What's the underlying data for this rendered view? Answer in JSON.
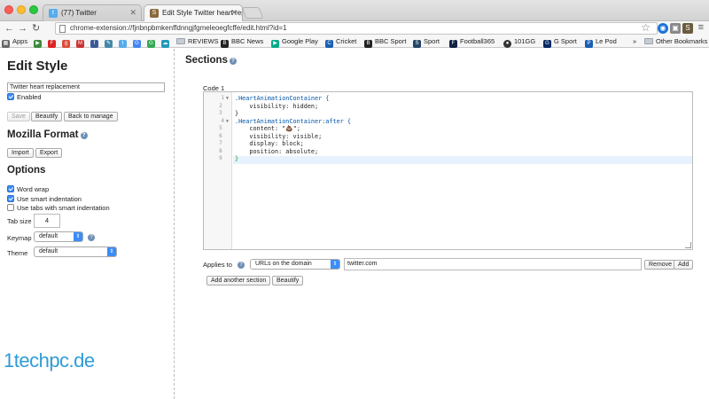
{
  "browser": {
    "tabs": [
      {
        "label": "(77) Twitter",
        "icon": "twitter-icon",
        "active": false
      },
      {
        "label": "Edit Style Twitter heart rep",
        "icon": "stylish-icon",
        "active": true
      }
    ],
    "url": "chrome-extension://fjnbnpbmkenffdnngjfgmeleoegfcffe/edit.html?id=1",
    "bookmarks": [
      "Apps",
      "REVIEWS",
      "BBC News",
      "Google Play",
      "Cricket",
      "BBC Sport",
      "Sport",
      "Football365",
      "101GG",
      "G Sport",
      "Le Pod",
      "Other Bookmarks"
    ]
  },
  "left": {
    "title": "Edit Style",
    "style_name": "Twitter heart replacement",
    "enabled_label": "Enabled",
    "buttons": {
      "save": "Save",
      "beautify": "Beautify",
      "back": "Back to manage"
    },
    "mozilla_title": "Mozilla Format",
    "import_label": "Import",
    "export_label": "Export",
    "options_title": "Options",
    "options": {
      "word_wrap": "Word wrap",
      "smart_indent": "Use smart indentation",
      "tabs_smart": "Use tabs with smart indentation"
    },
    "tab_size_label": "Tab size",
    "tab_size_value": "4",
    "keymap_label": "Keymap",
    "keymap_value": "default",
    "theme_label": "Theme",
    "theme_value": "default",
    "watermark": "1techpc.de"
  },
  "right": {
    "title": "Sections",
    "code_label": "Code 1",
    "code_lines": [
      ".HeartAnimationContainer {",
      "    visibility: hidden;",
      "}",
      ".HeartAnimationContainer:after {",
      "    content: \"💩\";",
      "    visibility: visible;",
      "    display: block;",
      "    position: absolute;",
      "}"
    ],
    "applies_label": "Applies to",
    "applies_select": "URLs on the domain",
    "domain_value": "twitter.com",
    "remove_label": "Remove",
    "add_label": "Add",
    "add_section_label": "Add another section",
    "beautify_label": "Beautify"
  }
}
